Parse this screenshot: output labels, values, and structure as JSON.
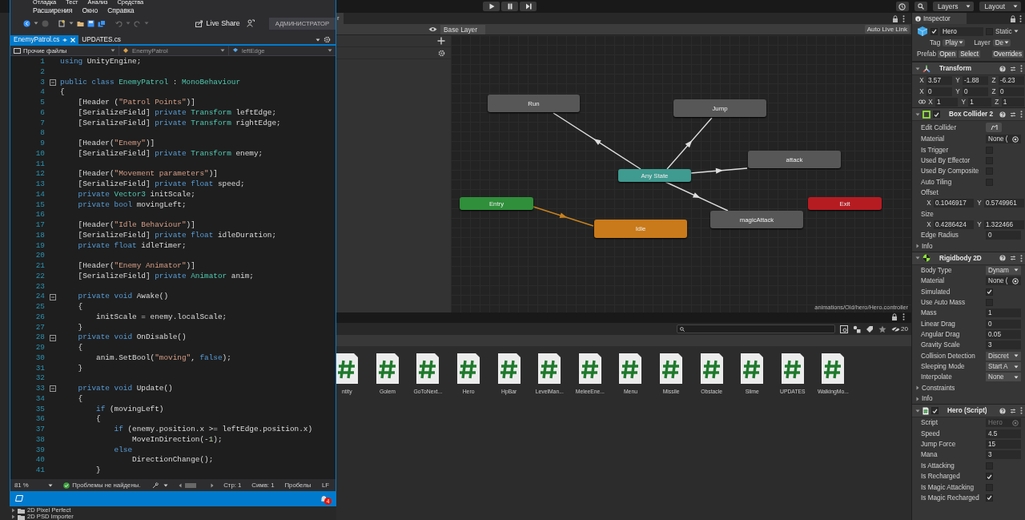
{
  "unity_toolbar": {
    "layers": "Layers",
    "layout": "Layout"
  },
  "code_editor": {
    "menu": [
      [
        "Отладка",
        "Тест",
        "Анализ",
        "Средства"
      ],
      [
        "Расширения",
        "Окно",
        "Справка"
      ]
    ],
    "toolbar": {
      "live_share": "Live Share",
      "role": "АДМИНИСТРАТОР"
    },
    "tabs": [
      {
        "label": "EnemyPatrol.cs",
        "selected": true
      },
      {
        "label": "UPDATES.cs",
        "selected": false
      }
    ],
    "nav": {
      "project": "Прочие файлы",
      "class": "EnemyPatrol",
      "member": "leftEdge"
    },
    "lines": [
      {
        "number": "1",
        "foldable": false,
        "tokens": [
          {
            "text": "using",
            "kind": "kw"
          },
          {
            "text": " UnityEngine;",
            "kind": "text"
          }
        ]
      },
      {
        "number": "2",
        "foldable": false
      },
      {
        "number": "3",
        "foldable": true,
        "tokens": [
          {
            "text": "public class ",
            "kind": "kw"
          },
          {
            "text": "EnemyPatrol",
            "kind": "type"
          },
          {
            "text": " : ",
            "kind": "text"
          },
          {
            "text": "MonoBehaviour",
            "kind": "type"
          }
        ]
      },
      {
        "number": "4",
        "foldable": false,
        "tokens": [
          {
            "text": "{",
            "kind": "text"
          }
        ]
      },
      {
        "number": "5",
        "foldable": false,
        "tokens": [
          {
            "text": "    [Header (",
            "kind": "text"
          },
          {
            "text": "\"Patrol Points\"",
            "kind": "str"
          },
          {
            "text": ")]",
            "kind": "text"
          }
        ]
      },
      {
        "number": "6",
        "foldable": false,
        "tokens": [
          {
            "text": "    [SerializeField] ",
            "kind": "text"
          },
          {
            "text": "private ",
            "kind": "kw"
          },
          {
            "text": "Transform",
            "kind": "type"
          },
          {
            "text": " leftEdge;",
            "kind": "text"
          }
        ]
      },
      {
        "number": "7",
        "foldable": false,
        "tokens": [
          {
            "text": "    [SerializeField] ",
            "kind": "text"
          },
          {
            "text": "private ",
            "kind": "kw"
          },
          {
            "text": "Transform",
            "kind": "type"
          },
          {
            "text": " rightEdge;",
            "kind": "text"
          }
        ]
      },
      {
        "number": "8",
        "foldable": false
      },
      {
        "number": "9",
        "foldable": false,
        "tokens": [
          {
            "text": "    [Header(",
            "kind": "text"
          },
          {
            "text": "\"Enemy\"",
            "kind": "str"
          },
          {
            "text": ")]",
            "kind": "text"
          }
        ]
      },
      {
        "number": "10",
        "foldable": false,
        "tokens": [
          {
            "text": "    [SerializeField] ",
            "kind": "text"
          },
          {
            "text": "private ",
            "kind": "kw"
          },
          {
            "text": "Transform",
            "kind": "type"
          },
          {
            "text": " enemy;",
            "kind": "text"
          }
        ]
      },
      {
        "number": "11",
        "foldable": false
      },
      {
        "number": "12",
        "foldable": false,
        "tokens": [
          {
            "text": "    [Header(",
            "kind": "text"
          },
          {
            "text": "\"Movement parameters\"",
            "kind": "str"
          },
          {
            "text": ")]",
            "kind": "text"
          }
        ]
      },
      {
        "number": "13",
        "foldable": false,
        "tokens": [
          {
            "text": "    [SerializeField] ",
            "kind": "text"
          },
          {
            "text": "private float",
            "kind": "kw"
          },
          {
            "text": " speed;",
            "kind": "text"
          }
        ]
      },
      {
        "number": "14",
        "foldable": false,
        "tokens": [
          {
            "text": "    private ",
            "kind": "kw"
          },
          {
            "text": "Vector3",
            "kind": "type"
          },
          {
            "text": " initScale;",
            "kind": "text"
          }
        ]
      },
      {
        "number": "15",
        "foldable": false,
        "tokens": [
          {
            "text": "    private bool",
            "kind": "kw"
          },
          {
            "text": " movingLeft;",
            "kind": "text"
          }
        ]
      },
      {
        "number": "16",
        "foldable": false
      },
      {
        "number": "17",
        "foldable": false,
        "tokens": [
          {
            "text": "    [Header(",
            "kind": "text"
          },
          {
            "text": "\"Idle Behaviour\"",
            "kind": "str"
          },
          {
            "text": ")]",
            "kind": "text"
          }
        ]
      },
      {
        "number": "18",
        "foldable": false,
        "tokens": [
          {
            "text": "    [SerializeField] ",
            "kind": "text"
          },
          {
            "text": "private float",
            "kind": "kw"
          },
          {
            "text": " idleDuration;",
            "kind": "text"
          }
        ]
      },
      {
        "number": "19",
        "foldable": false,
        "tokens": [
          {
            "text": "    private float",
            "kind": "kw"
          },
          {
            "text": " idleTimer;",
            "kind": "text"
          }
        ]
      },
      {
        "number": "20",
        "foldable": false
      },
      {
        "number": "21",
        "foldable": false,
        "tokens": [
          {
            "text": "    [Header(",
            "kind": "text"
          },
          {
            "text": "\"Enemy Animator\"",
            "kind": "str"
          },
          {
            "text": ")]",
            "kind": "text"
          }
        ]
      },
      {
        "number": "22",
        "foldable": false,
        "tokens": [
          {
            "text": "    [SerializeField] ",
            "kind": "text"
          },
          {
            "text": "private ",
            "kind": "kw"
          },
          {
            "text": "Animator",
            "kind": "type"
          },
          {
            "text": " anim;",
            "kind": "text"
          }
        ]
      },
      {
        "number": "23",
        "foldable": false
      },
      {
        "number": "24",
        "foldable": true,
        "tokens": [
          {
            "text": "    private void",
            "kind": "kw"
          },
          {
            "text": " Awake()",
            "kind": "text"
          }
        ]
      },
      {
        "number": "25",
        "foldable": false,
        "tokens": [
          {
            "text": "    {",
            "kind": "text"
          }
        ]
      },
      {
        "number": "26",
        "foldable": false,
        "tokens": [
          {
            "text": "        initScale = enemy.localScale;",
            "kind": "text"
          }
        ]
      },
      {
        "number": "27",
        "foldable": false,
        "tokens": [
          {
            "text": "    }",
            "kind": "text"
          }
        ]
      },
      {
        "number": "28",
        "foldable": true,
        "tokens": [
          {
            "text": "    private void",
            "kind": "kw"
          },
          {
            "text": " OnDisable()",
            "kind": "text"
          }
        ]
      },
      {
        "number": "29",
        "foldable": false,
        "tokens": [
          {
            "text": "    {",
            "kind": "text"
          }
        ]
      },
      {
        "number": "30",
        "foldable": false,
        "tokens": [
          {
            "text": "        anim.SetBool(",
            "kind": "text"
          },
          {
            "text": "\"moving\"",
            "kind": "str"
          },
          {
            "text": ", ",
            "kind": "text"
          },
          {
            "text": "false",
            "kind": "kw"
          },
          {
            "text": ");",
            "kind": "text"
          }
        ]
      },
      {
        "number": "31",
        "foldable": false,
        "tokens": [
          {
            "text": "    }",
            "kind": "text"
          }
        ]
      },
      {
        "number": "32",
        "foldable": false
      },
      {
        "number": "33",
        "foldable": true,
        "tokens": [
          {
            "text": "    private void",
            "kind": "kw"
          },
          {
            "text": " Update()",
            "kind": "text"
          }
        ]
      },
      {
        "number": "34",
        "foldable": false,
        "tokens": [
          {
            "text": "    {",
            "kind": "text"
          }
        ]
      },
      {
        "number": "35",
        "foldable": false,
        "tokens": [
          {
            "text": "        if",
            "kind": "kw"
          },
          {
            "text": " (movingLeft)",
            "kind": "text"
          }
        ]
      },
      {
        "number": "36",
        "foldable": false,
        "tokens": [
          {
            "text": "        {",
            "kind": "text"
          }
        ]
      },
      {
        "number": "37",
        "foldable": false,
        "tokens": [
          {
            "text": "            if",
            "kind": "kw"
          },
          {
            "text": " (enemy.position.x >= leftEdge.position.x)",
            "kind": "text"
          }
        ]
      },
      {
        "number": "38",
        "foldable": false,
        "tokens": [
          {
            "text": "                MoveInDirection(-",
            "kind": "text"
          },
          {
            "text": "1",
            "kind": "num"
          },
          {
            "text": ");",
            "kind": "text"
          }
        ]
      },
      {
        "number": "39",
        "foldable": false,
        "tokens": [
          {
            "text": "            else",
            "kind": "kw"
          }
        ]
      },
      {
        "number": "40",
        "foldable": false,
        "tokens": [
          {
            "text": "                DirectionChange();",
            "kind": "text"
          }
        ]
      },
      {
        "number": "41",
        "foldable": false,
        "tokens": [
          {
            "text": "        }",
            "kind": "text"
          }
        ]
      }
    ],
    "status": {
      "zoom": "81 %",
      "issues": "Проблемы не найдены.",
      "line": "Стр: 1",
      "column": "Симв: 1",
      "whitespace": "Пробелы",
      "line_ending": "LF"
    },
    "notifications": "4"
  },
  "project_tree": [
    {
      "name": "2D Pixel Perfect"
    },
    {
      "name": "2D PSD Importer"
    }
  ],
  "animator": {
    "tab": "r",
    "layer": "Base Layer",
    "live_link": "Auto Live Link",
    "states": [
      {
        "name": "Run",
        "kind": "state"
      },
      {
        "name": "Jump",
        "kind": "state"
      },
      {
        "name": "attack",
        "kind": "state"
      },
      {
        "name": "Any State",
        "kind": "any"
      },
      {
        "name": "Entry",
        "kind": "entry"
      },
      {
        "name": "Exit",
        "kind": "exit"
      },
      {
        "name": "magicAttack",
        "kind": "state"
      },
      {
        "name": "Idle",
        "kind": "default"
      }
    ],
    "path": "animations/Old/hero/Hero.controller"
  },
  "project": {
    "filter_count": "20",
    "assets": [
      {
        "name": "ntity"
      },
      {
        "name": "Golem"
      },
      {
        "name": "GoToNext..."
      },
      {
        "name": "Hero"
      },
      {
        "name": "HpBar"
      },
      {
        "name": "LevelMan..."
      },
      {
        "name": "MeleeEne..."
      },
      {
        "name": "Menu"
      },
      {
        "name": "Missile"
      },
      {
        "name": "Obstacle"
      },
      {
        "name": "Slime"
      },
      {
        "name": "UPDATES"
      },
      {
        "name": "WalkingMo..."
      }
    ]
  },
  "inspector": {
    "title": "Inspector",
    "object": {
      "active": true,
      "name": "Hero",
      "static": false,
      "static_label": "Static",
      "tag_label": "Tag",
      "tag": "Play",
      "layer_label": "Layer",
      "layer": "De",
      "prefab_label": "Prefab",
      "prefab_buttons": [
        "Open",
        "Select",
        "Overrides"
      ]
    },
    "components": [
      {
        "title": "Transform",
        "kind": "transform",
        "expanded": true,
        "rows": [
          {
            "kind": "vector",
            "linked": false,
            "axes": [
              {
                "axis": "X",
                "value": "3.57"
              },
              {
                "axis": "Y",
                "value": "-1.88"
              },
              {
                "axis": "Z",
                "value": "-6.23"
              }
            ]
          },
          {
            "kind": "vector",
            "linked": false,
            "axes": [
              {
                "axis": "X",
                "value": "0"
              },
              {
                "axis": "Y",
                "value": "0"
              },
              {
                "axis": "Z",
                "value": "0"
              }
            ]
          },
          {
            "kind": "vector",
            "linked": true,
            "axes": [
              {
                "axis": "X",
                "value": "1"
              },
              {
                "axis": "Y",
                "value": "1"
              },
              {
                "axis": "Z",
                "value": "1"
              }
            ]
          }
        ]
      },
      {
        "title": "Box Collider 2",
        "kind": "collider",
        "expanded": true,
        "enabled": true,
        "rows": [
          {
            "kind": "button",
            "label": "Edit Collider"
          },
          {
            "kind": "object",
            "label": "Material",
            "value": "None (",
            "disabled": false
          },
          {
            "kind": "check",
            "label": "Is Trigger",
            "checked": false
          },
          {
            "kind": "check",
            "label": "Used By Effector",
            "checked": false
          },
          {
            "kind": "check",
            "label": "Used By Composite",
            "checked": false
          },
          {
            "kind": "check",
            "label": "Auto Tiling",
            "checked": false
          },
          {
            "kind": "heading",
            "label": "Offset"
          },
          {
            "kind": "vector",
            "linked": false,
            "axes": [
              {
                "axis": "X",
                "value": "0.1046917"
              },
              {
                "axis": "Y",
                "value": "0.5749961"
              }
            ]
          },
          {
            "kind": "heading",
            "label": "Size"
          },
          {
            "kind": "vector",
            "linked": false,
            "axes": [
              {
                "axis": "X",
                "value": "0.4286424"
              },
              {
                "axis": "Y",
                "value": "1.322466"
              }
            ]
          },
          {
            "kind": "number",
            "label": "Edge Radius",
            "value": "0"
          },
          {
            "kind": "foldout",
            "label": "Info",
            "expanded": false
          }
        ]
      },
      {
        "title": "Rigidbody 2D",
        "kind": "rigidbody",
        "expanded": true,
        "rows": [
          {
            "kind": "dropdown",
            "label": "Body Type",
            "value": "Dynam"
          },
          {
            "kind": "object",
            "label": "Material",
            "value": "None (",
            "disabled": false
          },
          {
            "kind": "check",
            "label": "Simulated",
            "checked": true
          },
          {
            "kind": "check",
            "label": "Use Auto Mass",
            "checked": false
          },
          {
            "kind": "number",
            "label": "Mass",
            "value": "1"
          },
          {
            "kind": "number",
            "label": "Linear Drag",
            "value": "0"
          },
          {
            "kind": "number",
            "label": "Angular Drag",
            "value": "0.05"
          },
          {
            "kind": "number",
            "label": "Gravity Scale",
            "value": "3"
          },
          {
            "kind": "dropdown",
            "label": "Collision Detection",
            "value": "Discret"
          },
          {
            "kind": "dropdown",
            "label": "Sleeping Mode",
            "value": "Start A"
          },
          {
            "kind": "dropdown",
            "label": "Interpolate",
            "value": "None"
          },
          {
            "kind": "foldout",
            "label": "Constraints",
            "expanded": false
          },
          {
            "kind": "foldout",
            "label": "Info",
            "expanded": false
          }
        ]
      },
      {
        "title": "Hero (Script)",
        "kind": "script",
        "expanded": true,
        "enabled": true,
        "rows": [
          {
            "kind": "object",
            "label": "Script",
            "value": "Hero",
            "disabled": true
          },
          {
            "kind": "number",
            "label": "Speed",
            "value": "4.5"
          },
          {
            "kind": "number",
            "label": "Jump Force",
            "value": "15"
          },
          {
            "kind": "number",
            "label": "Mana",
            "value": "3"
          },
          {
            "kind": "check",
            "label": "Is Attacking",
            "checked": false
          },
          {
            "kind": "check",
            "label": "Is Recharged",
            "checked": true
          },
          {
            "kind": "check",
            "label": "Is Magic Attacking",
            "checked": false
          },
          {
            "kind": "check",
            "label": "Is Magic Recharged",
            "checked": true
          }
        ]
      }
    ]
  }
}
